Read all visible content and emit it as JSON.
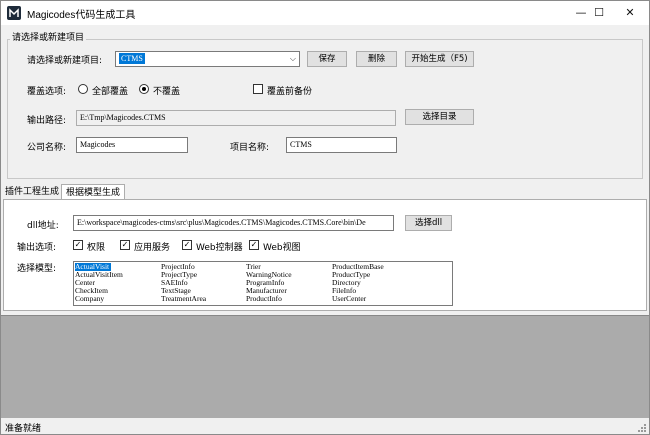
{
  "window": {
    "title": "Magicodes代码生成工具",
    "icon": "app-logo-icon",
    "minimize": "—",
    "maximize": "☐",
    "close": "✕"
  },
  "project_group": {
    "title": "请选择或新建项目",
    "project_label": "请选择或新建项目:",
    "project_value": "CTMS",
    "save_button": "保存",
    "delete_button": "删除",
    "generate_button": "开始生成（F5)",
    "overwrite_label": "覆盖选项:",
    "overwrite_all": "全部覆盖",
    "overwrite_none": "不覆盖",
    "overwrite_selected": "none",
    "backup_label": "覆盖前备份",
    "backup_checked": false,
    "output_label": "输出路径:",
    "output_value": "E:\\Tmp\\Magicodes.CTMS",
    "choose_dir_button": "选择目录",
    "company_label": "公司名称:",
    "company_value": "Magicodes",
    "project_name_label": "项目名称:",
    "project_name_value": "CTMS"
  },
  "tabs": [
    {
      "label": "插件工程生成",
      "active": false
    },
    {
      "label": "根据模型生成",
      "active": true
    }
  ],
  "model_tab": {
    "dll_label": "dll地址:",
    "dll_value": "E:\\workspace\\magicodes-ctms\\src\\plus\\Magicodes.CTMS\\Magicodes.CTMS.Core\\bin\\De",
    "choose_dll_button": "选择dll",
    "output_options_label": "输出选项:",
    "options": [
      {
        "label": "权限",
        "checked": true
      },
      {
        "label": "应用服务",
        "checked": true
      },
      {
        "label": "Web控制器",
        "checked": true
      },
      {
        "label": "Web视图",
        "checked": true
      }
    ],
    "model_label": "选择模型:",
    "models": [
      [
        "ActualVisit",
        "ProjectInfo",
        "Trier",
        "ProductItemBase"
      ],
      [
        "ActualVisitItem",
        "ProjectType",
        "WarningNotice",
        "ProductType"
      ],
      [
        "Center",
        "SAEInfo",
        "ProgramInfo",
        "Directory"
      ],
      [
        "CheckItem",
        "TextStage",
        "Manufacturer",
        "FileInfo"
      ],
      [
        "Company",
        "TreatmentArea",
        "ProductInfo",
        "UserCenter"
      ]
    ],
    "selected_model": "ActualVisit"
  },
  "status": {
    "text": "准备就绪"
  }
}
